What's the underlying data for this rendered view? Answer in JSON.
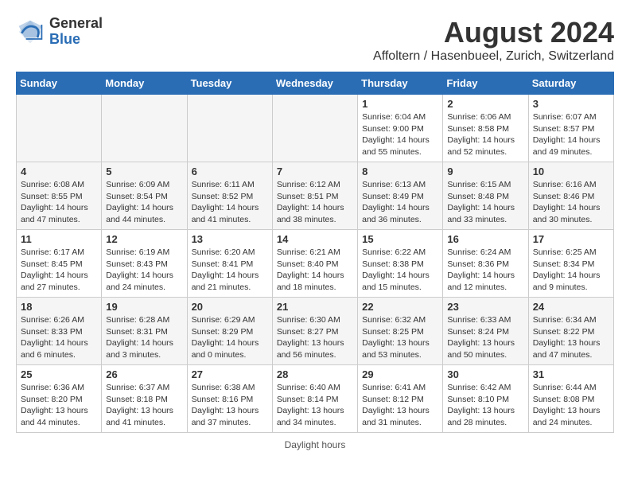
{
  "header": {
    "logo_general": "General",
    "logo_blue": "Blue",
    "month": "August 2024",
    "location": "Affoltern / Hasenbueel, Zurich, Switzerland"
  },
  "days_of_week": [
    "Sunday",
    "Monday",
    "Tuesday",
    "Wednesday",
    "Thursday",
    "Friday",
    "Saturday"
  ],
  "weeks": [
    [
      {
        "day": "",
        "info": "",
        "empty": true
      },
      {
        "day": "",
        "info": "",
        "empty": true
      },
      {
        "day": "",
        "info": "",
        "empty": true
      },
      {
        "day": "",
        "info": "",
        "empty": true
      },
      {
        "day": "1",
        "info": "Sunrise: 6:04 AM\nSunset: 9:00 PM\nDaylight: 14 hours\nand 55 minutes."
      },
      {
        "day": "2",
        "info": "Sunrise: 6:06 AM\nSunset: 8:58 PM\nDaylight: 14 hours\nand 52 minutes."
      },
      {
        "day": "3",
        "info": "Sunrise: 6:07 AM\nSunset: 8:57 PM\nDaylight: 14 hours\nand 49 minutes."
      }
    ],
    [
      {
        "day": "4",
        "info": "Sunrise: 6:08 AM\nSunset: 8:55 PM\nDaylight: 14 hours\nand 47 minutes."
      },
      {
        "day": "5",
        "info": "Sunrise: 6:09 AM\nSunset: 8:54 PM\nDaylight: 14 hours\nand 44 minutes."
      },
      {
        "day": "6",
        "info": "Sunrise: 6:11 AM\nSunset: 8:52 PM\nDaylight: 14 hours\nand 41 minutes."
      },
      {
        "day": "7",
        "info": "Sunrise: 6:12 AM\nSunset: 8:51 PM\nDaylight: 14 hours\nand 38 minutes."
      },
      {
        "day": "8",
        "info": "Sunrise: 6:13 AM\nSunset: 8:49 PM\nDaylight: 14 hours\nand 36 minutes."
      },
      {
        "day": "9",
        "info": "Sunrise: 6:15 AM\nSunset: 8:48 PM\nDaylight: 14 hours\nand 33 minutes."
      },
      {
        "day": "10",
        "info": "Sunrise: 6:16 AM\nSunset: 8:46 PM\nDaylight: 14 hours\nand 30 minutes."
      }
    ],
    [
      {
        "day": "11",
        "info": "Sunrise: 6:17 AM\nSunset: 8:45 PM\nDaylight: 14 hours\nand 27 minutes."
      },
      {
        "day": "12",
        "info": "Sunrise: 6:19 AM\nSunset: 8:43 PM\nDaylight: 14 hours\nand 24 minutes."
      },
      {
        "day": "13",
        "info": "Sunrise: 6:20 AM\nSunset: 8:41 PM\nDaylight: 14 hours\nand 21 minutes."
      },
      {
        "day": "14",
        "info": "Sunrise: 6:21 AM\nSunset: 8:40 PM\nDaylight: 14 hours\nand 18 minutes."
      },
      {
        "day": "15",
        "info": "Sunrise: 6:22 AM\nSunset: 8:38 PM\nDaylight: 14 hours\nand 15 minutes."
      },
      {
        "day": "16",
        "info": "Sunrise: 6:24 AM\nSunset: 8:36 PM\nDaylight: 14 hours\nand 12 minutes."
      },
      {
        "day": "17",
        "info": "Sunrise: 6:25 AM\nSunset: 8:34 PM\nDaylight: 14 hours\nand 9 minutes."
      }
    ],
    [
      {
        "day": "18",
        "info": "Sunrise: 6:26 AM\nSunset: 8:33 PM\nDaylight: 14 hours\nand 6 minutes."
      },
      {
        "day": "19",
        "info": "Sunrise: 6:28 AM\nSunset: 8:31 PM\nDaylight: 14 hours\nand 3 minutes."
      },
      {
        "day": "20",
        "info": "Sunrise: 6:29 AM\nSunset: 8:29 PM\nDaylight: 14 hours\nand 0 minutes."
      },
      {
        "day": "21",
        "info": "Sunrise: 6:30 AM\nSunset: 8:27 PM\nDaylight: 13 hours\nand 56 minutes."
      },
      {
        "day": "22",
        "info": "Sunrise: 6:32 AM\nSunset: 8:25 PM\nDaylight: 13 hours\nand 53 minutes."
      },
      {
        "day": "23",
        "info": "Sunrise: 6:33 AM\nSunset: 8:24 PM\nDaylight: 13 hours\nand 50 minutes."
      },
      {
        "day": "24",
        "info": "Sunrise: 6:34 AM\nSunset: 8:22 PM\nDaylight: 13 hours\nand 47 minutes."
      }
    ],
    [
      {
        "day": "25",
        "info": "Sunrise: 6:36 AM\nSunset: 8:20 PM\nDaylight: 13 hours\nand 44 minutes."
      },
      {
        "day": "26",
        "info": "Sunrise: 6:37 AM\nSunset: 8:18 PM\nDaylight: 13 hours\nand 41 minutes."
      },
      {
        "day": "27",
        "info": "Sunrise: 6:38 AM\nSunset: 8:16 PM\nDaylight: 13 hours\nand 37 minutes."
      },
      {
        "day": "28",
        "info": "Sunrise: 6:40 AM\nSunset: 8:14 PM\nDaylight: 13 hours\nand 34 minutes."
      },
      {
        "day": "29",
        "info": "Sunrise: 6:41 AM\nSunset: 8:12 PM\nDaylight: 13 hours\nand 31 minutes."
      },
      {
        "day": "30",
        "info": "Sunrise: 6:42 AM\nSunset: 8:10 PM\nDaylight: 13 hours\nand 28 minutes."
      },
      {
        "day": "31",
        "info": "Sunrise: 6:44 AM\nSunset: 8:08 PM\nDaylight: 13 hours\nand 24 minutes."
      }
    ]
  ],
  "footer": "Daylight hours"
}
